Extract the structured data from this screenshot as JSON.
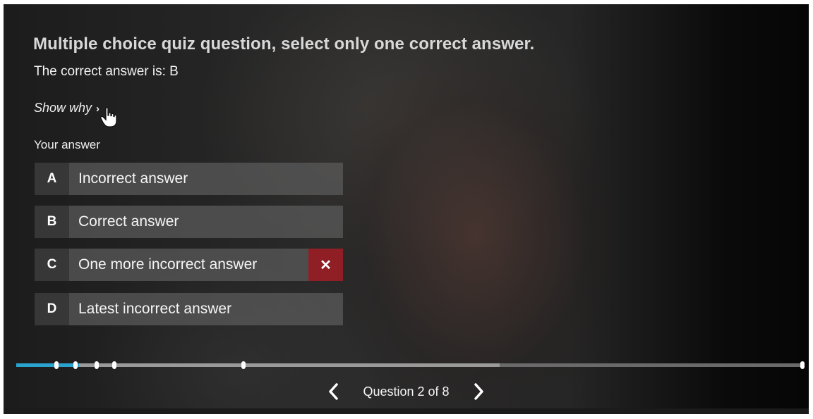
{
  "question": {
    "title": "Multiple choice quiz question, select only one correct answer.",
    "result_text": "The correct answer is: B",
    "show_why_label": "Show why",
    "your_answer_label": "Your answer"
  },
  "options": [
    {
      "letter": "A",
      "label": "Incorrect answer",
      "selected": false
    },
    {
      "letter": "B",
      "label": "Correct answer",
      "selected": false
    },
    {
      "letter": "C",
      "label": "One more incorrect answer",
      "selected": true,
      "mark": "✕"
    },
    {
      "letter": "D",
      "label": "Latest incorrect answer",
      "selected": false
    }
  ],
  "progress": {
    "played_fraction": 0.08,
    "buffered_fraction": 0.615,
    "marker_fractions": [
      0.051,
      0.075,
      0.102,
      0.125,
      0.289,
      1.0
    ],
    "colors": {
      "played": "#2aa3cf",
      "incorrect_mark": "#8f1f25"
    }
  },
  "navigation": {
    "label": "Question 2 of 8",
    "prev_icon": "chevron-left-icon",
    "next_icon": "chevron-right-icon"
  }
}
